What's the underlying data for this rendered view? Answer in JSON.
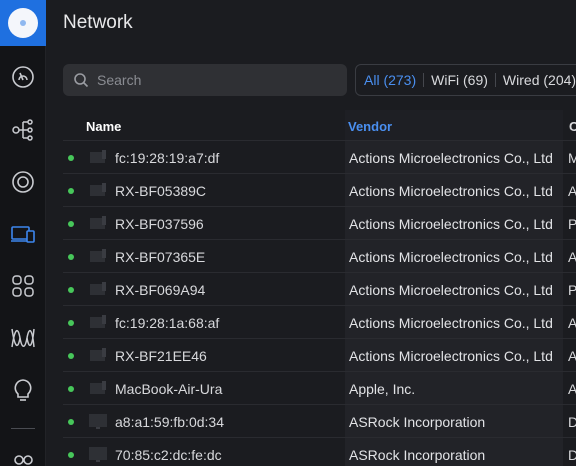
{
  "header": {
    "title": "Network"
  },
  "sidebar": {
    "items": [
      {
        "icon": "dashboard-icon"
      },
      {
        "icon": "topology-icon"
      },
      {
        "icon": "devices-icon"
      },
      {
        "icon": "clients-icon",
        "active": true
      },
      {
        "icon": "apps-icon"
      },
      {
        "icon": "insights-icon"
      },
      {
        "icon": "alerts-icon"
      },
      {
        "icon": "settings-icon"
      }
    ]
  },
  "search": {
    "placeholder": "Search"
  },
  "filters": [
    {
      "label": "All (273)",
      "active": true
    },
    {
      "label": "WiFi (69)",
      "active": false
    },
    {
      "label": "Wired (204)",
      "active": false
    }
  ],
  "table": {
    "columns": {
      "name": "Name",
      "vendor": "Vendor",
      "extra": "C"
    },
    "rows": [
      {
        "name": "fc:19:28:19:a7:df",
        "vendor": "Actions Microelectronics Co., Ltd",
        "extra": "M",
        "icon": "tv"
      },
      {
        "name": "RX-BF05389C",
        "vendor": "Actions Microelectronics Co., Ltd",
        "extra": "A",
        "icon": "tv"
      },
      {
        "name": "RX-BF037596",
        "vendor": "Actions Microelectronics Co., Ltd",
        "extra": "P",
        "icon": "tv"
      },
      {
        "name": "RX-BF07365E",
        "vendor": "Actions Microelectronics Co., Ltd",
        "extra": "A",
        "icon": "tv"
      },
      {
        "name": "RX-BF069A94",
        "vendor": "Actions Microelectronics Co., Ltd",
        "extra": "P",
        "icon": "tv"
      },
      {
        "name": "fc:19:28:1a:68:af",
        "vendor": "Actions Microelectronics Co., Ltd",
        "extra": "A",
        "icon": "tv"
      },
      {
        "name": "RX-BF21EE46",
        "vendor": "Actions Microelectronics Co., Ltd",
        "extra": "A",
        "icon": "tv"
      },
      {
        "name": "MacBook-Air-Ura",
        "vendor": "Apple, Inc.",
        "extra": "A",
        "icon": "tv"
      },
      {
        "name": "a8:a1:59:fb:0d:34",
        "vendor": "ASRock Incorporation",
        "extra": "D",
        "icon": "monitor"
      },
      {
        "name": "70:85:c2:dc:fe:dc",
        "vendor": "ASRock Incorporation",
        "extra": "D",
        "icon": "monitor"
      }
    ]
  },
  "colors": {
    "accent": "#4a8ff0",
    "online": "#47c75a",
    "logo_bg": "#1f70e0"
  }
}
